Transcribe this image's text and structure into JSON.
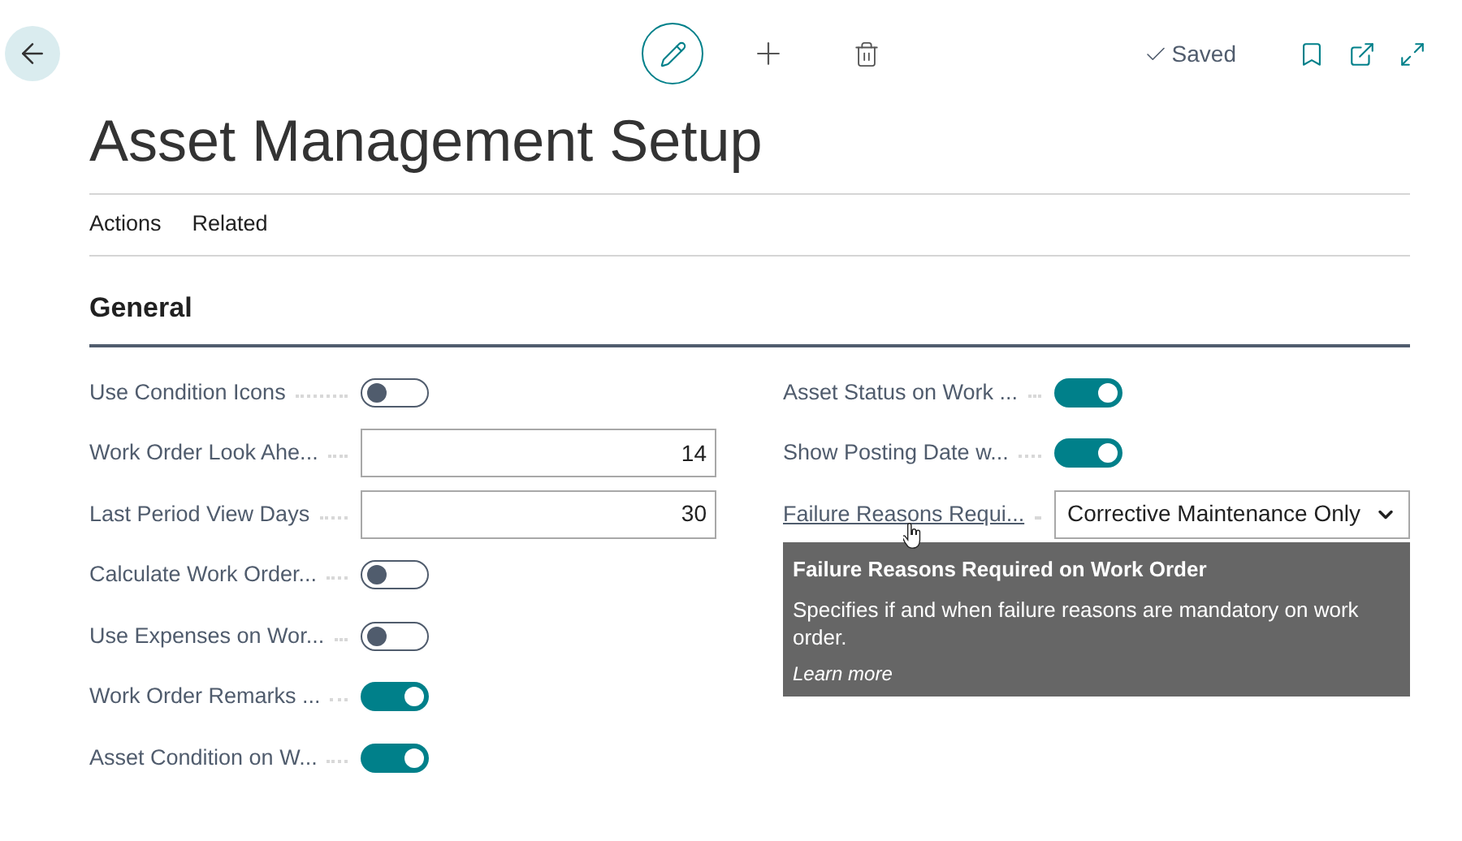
{
  "status": "Saved",
  "title": "Asset Management Setup",
  "action_tabs": [
    "Actions",
    "Related"
  ],
  "section": "General",
  "left_fields": [
    {
      "label": "Use Condition Icons",
      "kind": "toggle",
      "on": false
    },
    {
      "label": "Work Order Look Ahe...",
      "kind": "number",
      "value": "14"
    },
    {
      "label": "Last Period View Days",
      "kind": "number",
      "value": "30"
    },
    {
      "label": "Calculate Work Order...",
      "kind": "toggle",
      "on": false
    },
    {
      "label": "Use Expenses on Wor...",
      "kind": "toggle",
      "on": false
    },
    {
      "label": "Work Order Remarks ...",
      "kind": "toggle",
      "on": true
    },
    {
      "label": "Asset Condition on W...",
      "kind": "toggle",
      "on": true
    }
  ],
  "right_fields": [
    {
      "label": "Asset Status on Work ...",
      "kind": "toggle",
      "on": true,
      "hovered": false
    },
    {
      "label": "Show Posting Date w...",
      "kind": "toggle",
      "on": true,
      "hovered": false
    },
    {
      "label": "Failure Reasons Requi...",
      "kind": "select",
      "value": "Corrective Maintenance Only",
      "hovered": true
    }
  ],
  "tooltip": {
    "title": "Failure Reasons Required on Work Order",
    "text": "Specifies if and when failure reasons are mandatory on work order.",
    "link": "Learn more"
  }
}
